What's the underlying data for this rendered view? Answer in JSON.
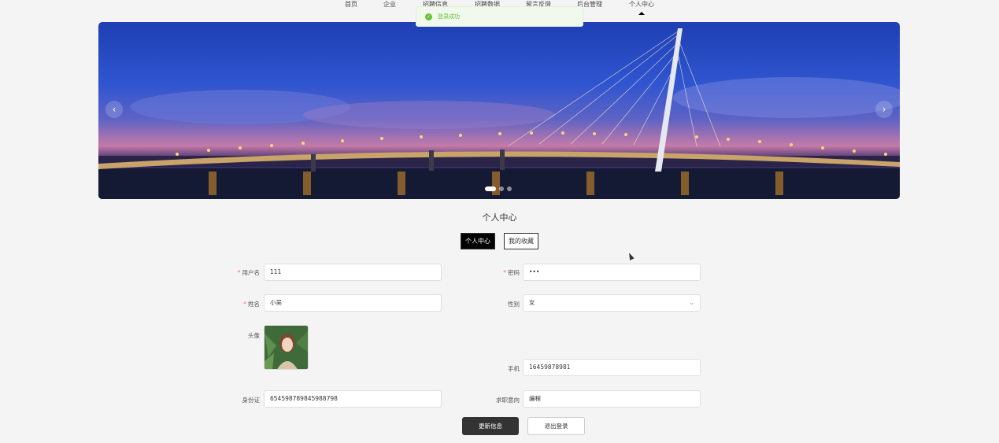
{
  "nav": {
    "items": [
      "首页",
      "企业",
      "招聘信息",
      "招聘数据",
      "留言反馈",
      "后台管理",
      "个人中心"
    ],
    "active_index": 6
  },
  "toast": {
    "text": "登录成功",
    "icon": "check-circle-icon"
  },
  "banner": {
    "prev_icon": "‹",
    "next_icon": "›",
    "slide_count": 3,
    "active_slide": 1
  },
  "page": {
    "title": "个人中心"
  },
  "tabs": [
    "个人中心",
    "我的收藏"
  ],
  "form": {
    "username": {
      "label": "用户名",
      "value": "111",
      "required": true
    },
    "password": {
      "label": "密码",
      "value": "•••",
      "required": true
    },
    "name": {
      "label": "姓名",
      "value": "小吴",
      "required": true
    },
    "gender": {
      "label": "性别",
      "value": "女"
    },
    "avatar": {
      "label": "头像"
    },
    "phone": {
      "label": "手机",
      "value": "16459878981"
    },
    "id_card": {
      "label": "身份证",
      "value": "654598789845988798"
    },
    "job_intent": {
      "label": "求职意向",
      "value": "编程"
    }
  },
  "buttons": {
    "update": "更新信息",
    "logout": "退出登录"
  },
  "colors": {
    "accent": "#333333",
    "success": "#67c23a",
    "required": "#f56c6c"
  }
}
